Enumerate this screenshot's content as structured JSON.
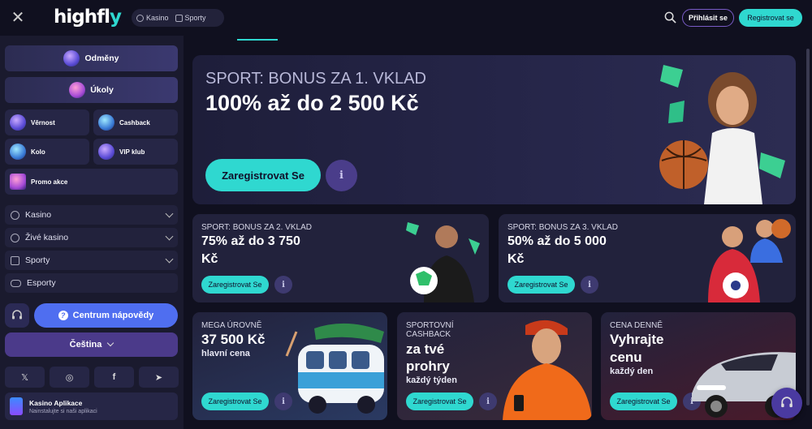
{
  "header": {
    "logo_main": "highfl",
    "logo_y": "y",
    "nav": [
      "Kasino",
      "Sporty"
    ],
    "login_label": "Přihlásit se",
    "register_label": "Registrovat se"
  },
  "sidebar": {
    "big_items": [
      "Odměny",
      "Úkoly"
    ],
    "tiles": [
      "Věrnost",
      "Cashback",
      "Kolo",
      "VIP klub",
      "Promo akce"
    ],
    "nav_items": [
      "Kasino",
      "Živé kasino",
      "Sporty",
      "Esporty"
    ],
    "help_label": "Centrum nápovědy",
    "language_label": "Čeština",
    "app_title": "Kasino Aplikace",
    "app_subtitle": "Nainstalujte si naši aplikaci"
  },
  "hero": {
    "subtitle": "SPORT: BONUS ZA 1. VKLAD",
    "title": "100% až do 2 500 Kč",
    "cta": "Zaregistrovat Se",
    "info": "i"
  },
  "cards_row1": [
    {
      "sub": "SPORT: BONUS ZA 2. VKLAD",
      "title_l1": "75% až do 3 750",
      "title_l2": "Kč",
      "cta": "Zaregistrovat Se"
    },
    {
      "sub": "SPORT: BONUS ZA 3. VKLAD",
      "title_l1": "50% až do 5 000",
      "title_l2": "Kč",
      "cta": "Zaregistrovat Se"
    }
  ],
  "cards_row2": [
    {
      "sub": "MEGA ÚROVNĚ",
      "big": "37 500 Kč",
      "small": "hlavní cena",
      "cta": "Zaregistrovat Se"
    },
    {
      "sub_l1": "SPORTOVNÍ",
      "sub_l2": "CASHBACK",
      "big_l1": "za tvé",
      "big_l2": "prohry",
      "small": "každý týden",
      "cta": "Zaregistrovat Se"
    },
    {
      "sub": "CENA DENNĚ",
      "big_l1": "Vyhrajte",
      "big_l2": "cenu",
      "small": "každý den",
      "cta": "Zaregistrovat Se"
    }
  ],
  "colors": {
    "accent": "#2fd8d0",
    "purple": "#4b3a8a",
    "help": "#4f6ef0"
  }
}
